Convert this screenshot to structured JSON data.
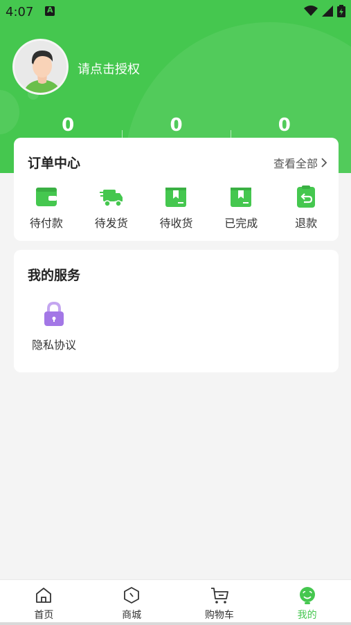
{
  "status_bar": {
    "time": "4:07",
    "notification_letter": "A"
  },
  "profile": {
    "login_prompt": "请点击授权"
  },
  "stats": [
    "0",
    "0",
    "0"
  ],
  "orders": {
    "title": "订单中心",
    "view_all": "查看全部",
    "items": [
      {
        "label": "待付款",
        "icon": "wallet-icon"
      },
      {
        "label": "待发货",
        "icon": "truck-icon"
      },
      {
        "label": "待收货",
        "icon": "package-icon"
      },
      {
        "label": "已完成",
        "icon": "box-done-icon"
      },
      {
        "label": "退款",
        "icon": "refund-icon"
      }
    ]
  },
  "services": {
    "title": "我的服务",
    "items": [
      {
        "label": "隐私协议",
        "icon": "lock-icon"
      }
    ]
  },
  "tabbar": {
    "items": [
      {
        "label": "首页",
        "icon": "home-icon"
      },
      {
        "label": "商城",
        "icon": "shop-icon"
      },
      {
        "label": "购物车",
        "icon": "cart-icon"
      },
      {
        "label": "我的",
        "icon": "profile-icon"
      }
    ],
    "active_index": 3
  },
  "colors": {
    "brand": "#45c74f",
    "lock": "#a377e6",
    "background": "#f4f4f4"
  }
}
